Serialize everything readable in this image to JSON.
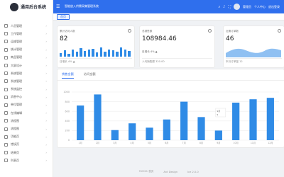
{
  "app": {
    "logo_text": "通用后台系统"
  },
  "sidebar": {
    "items": [
      {
        "label": "人员管理",
        "icon": "user-icon",
        "has_arrow": true
      },
      {
        "label": "工作管理",
        "icon": "briefcase-icon",
        "has_arrow": true
      },
      {
        "label": "运维管理",
        "icon": "tools-icon",
        "has_arrow": true
      },
      {
        "label": "统计管理",
        "icon": "chart-icon",
        "has_arrow": true
      },
      {
        "label": "商品管理",
        "icon": "box-icon",
        "has_arrow": true
      },
      {
        "label": "大屏设计",
        "icon": "monitor-icon",
        "has_arrow": true
      },
      {
        "label": "系统管理",
        "icon": "gear-icon",
        "has_arrow": true
      },
      {
        "label": "系统管理",
        "icon": "settings-icon",
        "has_arrow": true
      },
      {
        "label": "系统监控",
        "icon": "monitor-icon",
        "has_arrow": true
      },
      {
        "label": "消息中心",
        "icon": "bell-icon",
        "has_arrow": true
      },
      {
        "label": "单位管理",
        "icon": "building-icon",
        "has_arrow": true
      },
      {
        "label": "在线编辑",
        "icon": "edit-icon",
        "has_arrow": true
      },
      {
        "label": "流程图",
        "icon": "flow-icon",
        "has_arrow": true
      },
      {
        "label": "流程图",
        "icon": "flow-icon",
        "has_arrow": true
      },
      {
        "label": "功能页",
        "icon": "page-icon",
        "has_arrow": true
      },
      {
        "label": "错误页",
        "icon": "warning-icon",
        "has_arrow": true
      },
      {
        "label": "结果页",
        "icon": "check-icon",
        "has_arrow": true
      },
      {
        "label": "列表页",
        "icon": "list-icon",
        "has_arrow": true
      }
    ]
  },
  "header": {
    "breadcrumb": "智能放入供需采集管理系统",
    "user_name": "管理员",
    "role_text": "个人中心",
    "logout_text": "退出登录",
    "icons": [
      "search-icon",
      "bell-icon",
      "fullscreen-icon",
      "globe-icon"
    ]
  },
  "tabs": [
    {
      "label": "首页"
    }
  ],
  "cards": [
    {
      "title": "累计访问人数",
      "value": "82",
      "footer": "日增长 4% ▲",
      "mini_bars": [
        0.35,
        0.6,
        0.3,
        0.7,
        0.5,
        0.8,
        0.55,
        0.65,
        0.75,
        0.4,
        0.9,
        0.5,
        0.7,
        0.6,
        0.45,
        0.85,
        0.7,
        0.55
      ]
    },
    {
      "title": "总销售额",
      "value": "108984.46",
      "meta": "日增长 4% ▲",
      "footer": "人均销售额 320.00"
    },
    {
      "title": "近期订单数",
      "value": "46",
      "footer": "本月订单量 12"
    }
  ],
  "chart_panel": {
    "tabs": [
      {
        "label": "销售金额",
        "active": true
      },
      {
        "label": "访问金额",
        "active": false
      }
    ],
    "tooltip": {
      "month": "9月",
      "label": "9",
      "value": ""
    }
  },
  "chart_data": {
    "type": "bar",
    "categories": [
      "1月",
      "2月",
      "3月",
      "4月",
      "5月",
      "6月",
      "7月",
      "8月",
      "9月",
      "10月",
      "11月",
      "12月"
    ],
    "values": [
      720,
      950,
      210,
      350,
      260,
      430,
      800,
      480,
      200,
      780,
      850,
      880
    ],
    "ylim": [
      0,
      1000
    ],
    "yticks": [
      0,
      200,
      400,
      600,
      800,
      1000
    ],
    "color": "#2f8be6",
    "grid": true
  },
  "footer": {
    "links": [
      "©2021 首页",
      "Ant Design",
      "Ice 2.0.0"
    ]
  }
}
